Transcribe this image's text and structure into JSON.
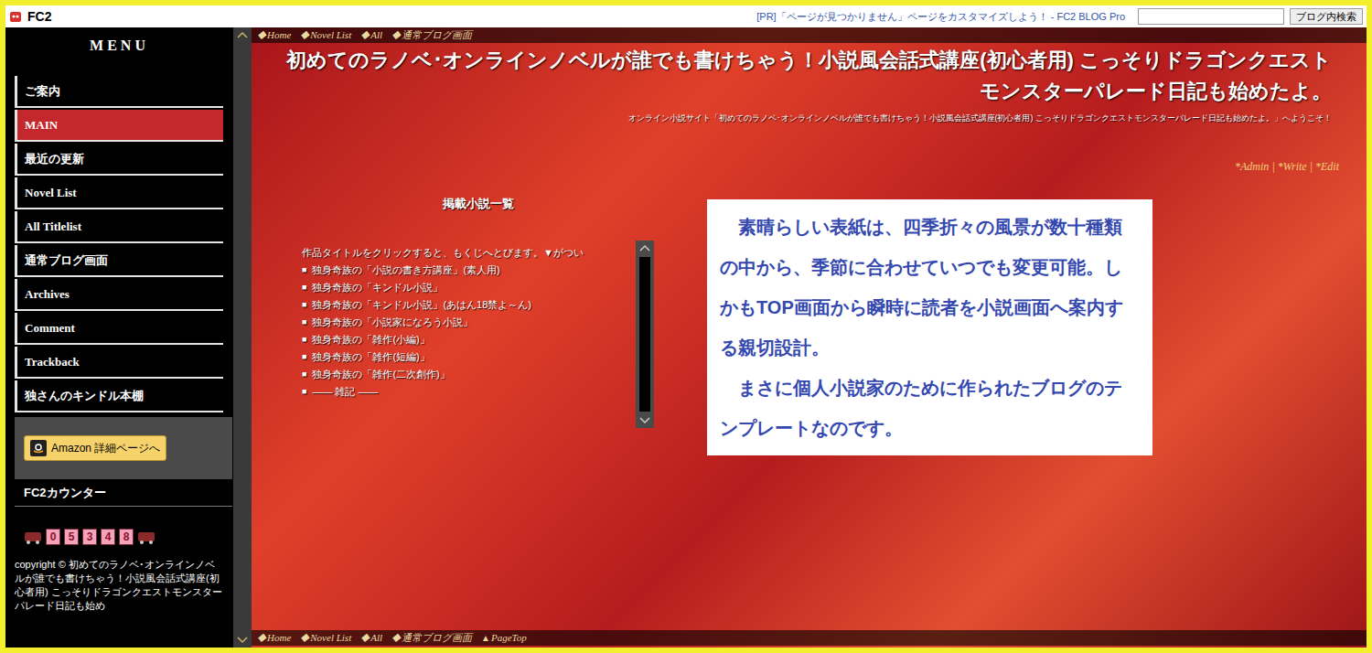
{
  "header": {
    "logo": "FC2",
    "pr": "[PR]「ページが見つかりません」ページをカスタマイズしよう！ - FC2 BLOG Pro",
    "search_placeholder": "",
    "search_button": "ブログ内検索"
  },
  "sidebar": {
    "title": "MENU",
    "items": [
      {
        "label": "ご案内",
        "selected": false
      },
      {
        "label": "MAIN",
        "selected": true
      },
      {
        "label": "最近の更新",
        "selected": false
      },
      {
        "label": "Novel List",
        "selected": false
      },
      {
        "label": "All Titlelist",
        "selected": false
      },
      {
        "label": "通常ブログ画面",
        "selected": false
      },
      {
        "label": "Archives",
        "selected": false
      },
      {
        "label": "Comment",
        "selected": false
      },
      {
        "label": "Trackback",
        "selected": false
      },
      {
        "label": "独さんのキンドル本棚",
        "selected": false
      }
    ],
    "amazon_button": "Amazon 詳細ページへ",
    "counter_label": "FC2カウンター",
    "counter_digits": [
      "0",
      "5",
      "3",
      "4",
      "8"
    ],
    "copyright": "copyright © 初めてのラノベ･オンラインノベルが誰でも書けちゃう！小説風会話式講座(初心者用) こっそりドラゴンクエストモンスターパレード日記も始め"
  },
  "nav_top": [
    {
      "icon": "◆",
      "label": "Home"
    },
    {
      "icon": "◆",
      "label": "Novel List"
    },
    {
      "icon": "◆",
      "label": "All"
    },
    {
      "icon": "◆",
      "label": "通常ブログ画面"
    }
  ],
  "nav_bottom": [
    {
      "icon": "◆",
      "label": "Home"
    },
    {
      "icon": "◆",
      "label": "Novel List"
    },
    {
      "icon": "◆",
      "label": "All"
    },
    {
      "icon": "◆",
      "label": "通常ブログ画面"
    },
    {
      "icon": "▲",
      "label": "PageTop"
    }
  ],
  "main": {
    "title": "初めてのラノベ･オンラインノベルが誰でも書けちゃう！小説風会話式講座(初心者用) こっそりドラゴンクエストモンスターパレード日記も始めたよ。",
    "subtitle": "オンライン小説サイト「初めてのラノベ･オンラインノベルが誰でも書けちゃう！小説風会話式講座(初心者用) こっそりドラゴンクエストモンスターパレード日記も始めたよ。」へようこそ！",
    "admin_links": [
      "*Admin",
      "*Write",
      "*Edit"
    ],
    "separator": "|"
  },
  "novel_list": {
    "heading": "掲載小説一覧",
    "intro": "作品タイトルをクリックすると、もくじへとびます。▼がつい",
    "bullet": "■",
    "items": [
      "独身奇族の「小説の書き方講座」(素人用)",
      "独身奇族の「キンドル小説」",
      "独身奇族の「キンドル小説」(あはん18禁よ～ん)",
      "独身奇族の「小説家になろう小説」",
      "独身奇族の「雑作(小編)」",
      "独身奇族の「雑作(短編)」",
      "独身奇族の「雑作(二次創作)」",
      "―― 雑記 ――"
    ]
  },
  "promo": {
    "paragraphs": [
      "素晴らしい表紙は、四季折々の風景が数十種類の中から、季節に合わせていつでも変更可能。しかもTOP画面から瞬時に読者を小説画面へ案内する親切設計。",
      "まさに個人小説家のために作られたブログのテンプレートなのです。"
    ]
  }
}
